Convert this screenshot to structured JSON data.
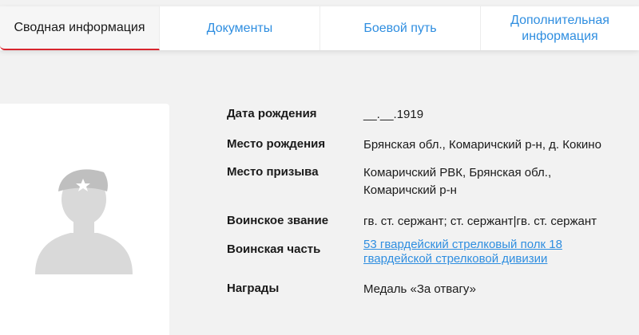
{
  "tabs": [
    {
      "label": "Сводная информация",
      "active": true
    },
    {
      "label": "Документы",
      "active": false
    },
    {
      "label": "Боевой путь",
      "active": false
    },
    {
      "label": "Дополнительная информация",
      "active": false
    }
  ],
  "photo": {
    "icon": "soldier-silhouette-icon"
  },
  "info": {
    "birth_date": {
      "label": "Дата рождения",
      "value": "__.__.1919"
    },
    "birth_place": {
      "label": "Место рождения",
      "value": "Брянская обл., Комаричский р-н, д. Кокино"
    },
    "draft_place": {
      "label": "Место призыва",
      "value": "Комаричский РВК, Брянская обл., Комаричский р-н"
    },
    "rank": {
      "label": "Воинское звание",
      "value": "гв. ст. сержант; ст. сержант|гв. ст. сержант"
    },
    "unit": {
      "label": "Воинская часть",
      "value": "53 гвардейский стрелковый полк 18 гвардейской стрелковой дивизии"
    },
    "awards": {
      "label": "Награды",
      "value": "Медаль «За отвагу»"
    }
  },
  "colors": {
    "accent": "#d8262f",
    "link": "#2f8ee0",
    "background": "#f2f2f2"
  }
}
